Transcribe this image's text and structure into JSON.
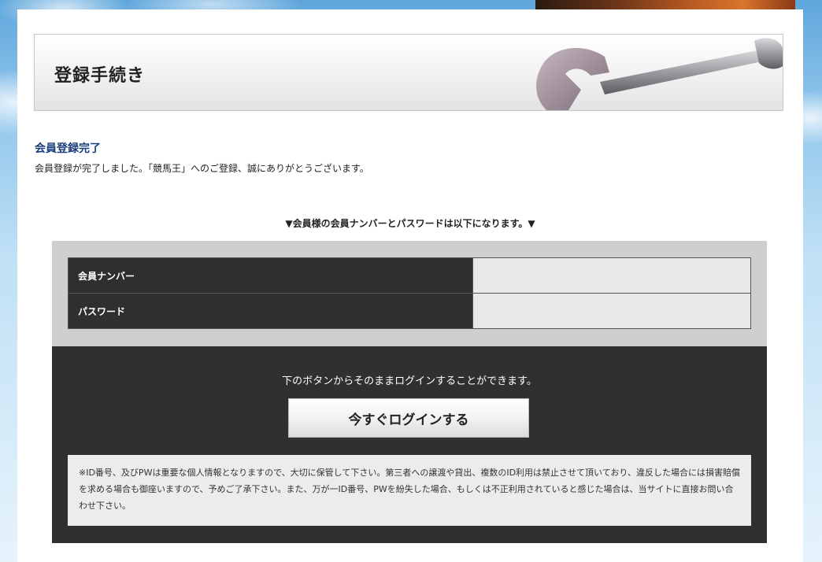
{
  "header": {
    "title": "登録手続き"
  },
  "completion": {
    "title": "会員登録完了",
    "message": "会員登録が完了しました。「競馬王」へのご登録、誠にありがとうございます。"
  },
  "credentials": {
    "heading": "▼会員様の会員ナンバーとパスワードは以下になります。▼",
    "rows": [
      {
        "label": "会員ナンバー",
        "value": ""
      },
      {
        "label": "パスワード",
        "value": ""
      }
    ]
  },
  "login": {
    "text": "下のボタンからそのままログインすることができます。",
    "button_label": "今すぐログインする"
  },
  "warning": {
    "text": "※ID番号、及びPWは重要な個人情報となりますので、大切に保管して下さい。第三者への譲渡や貸出、複数のID利用は禁止させて頂いており、違反した場合には損害賠償を求める場合も御座いますので、予めご了承下さい。また、万が一ID番号、PWを紛失した場合、もしくは不正利用されていると感じた場合は、当サイトに直接お問い合わせ下さい。"
  },
  "colors": {
    "title_blue": "#1a3d7c",
    "dark_panel": "#303030",
    "gray_panel": "#cfcfcf"
  }
}
